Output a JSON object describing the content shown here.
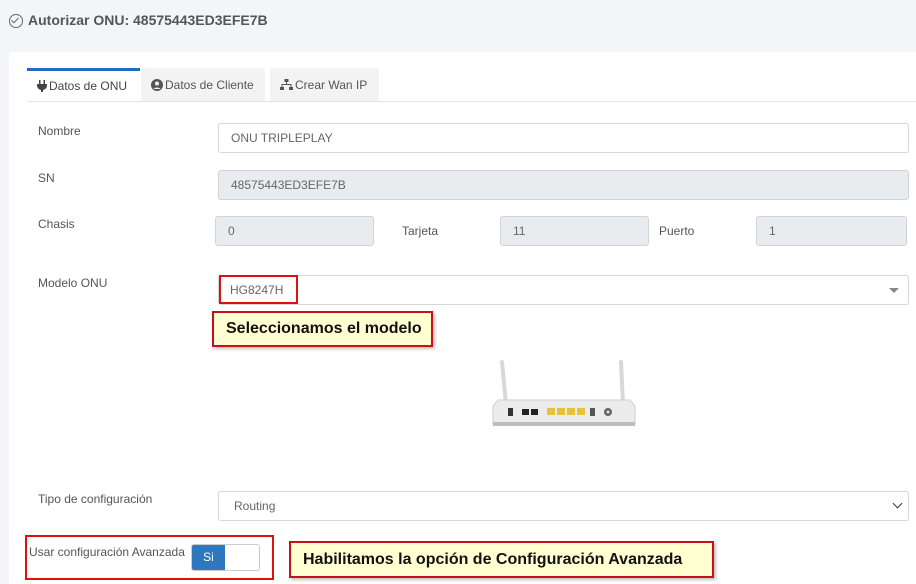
{
  "header": {
    "title": "Autorizar ONU: 48575443ED3EFE7B"
  },
  "tabs": [
    {
      "label": "Datos de ONU",
      "icon": "plug-icon",
      "active": true
    },
    {
      "label": "Datos de Cliente",
      "icon": "user-circle-icon",
      "active": false
    },
    {
      "label": "Crear Wan IP",
      "icon": "sitemap-icon",
      "active": false
    }
  ],
  "form": {
    "nombre": {
      "label": "Nombre",
      "value": "ONU TRIPLEPLAY"
    },
    "sn": {
      "label": "SN",
      "value": "48575443ED3EFE7B"
    },
    "chasis": {
      "label": "Chasis",
      "value": "0"
    },
    "tarjeta": {
      "label": "Tarjeta",
      "value": "11"
    },
    "puerto": {
      "label": "Puerto",
      "value": "1"
    },
    "modelo": {
      "label": "Modelo ONU",
      "value": "HG8247H"
    },
    "tipo": {
      "label": "Tipo de configuración",
      "value": "Routing"
    },
    "avanzada": {
      "label": "Usar configuración Avanzada",
      "toggle_on": "Si"
    }
  },
  "annotations": {
    "modelo_note": "Seleccionamos el modelo",
    "avanzada_note": "Habilitamos la opción de Configuración Avanzada"
  },
  "colors": {
    "accent": "#1f6dc2",
    "toggle": "#2f78c0",
    "highlight": "#d11111",
    "note_bg": "#ffffd2"
  }
}
